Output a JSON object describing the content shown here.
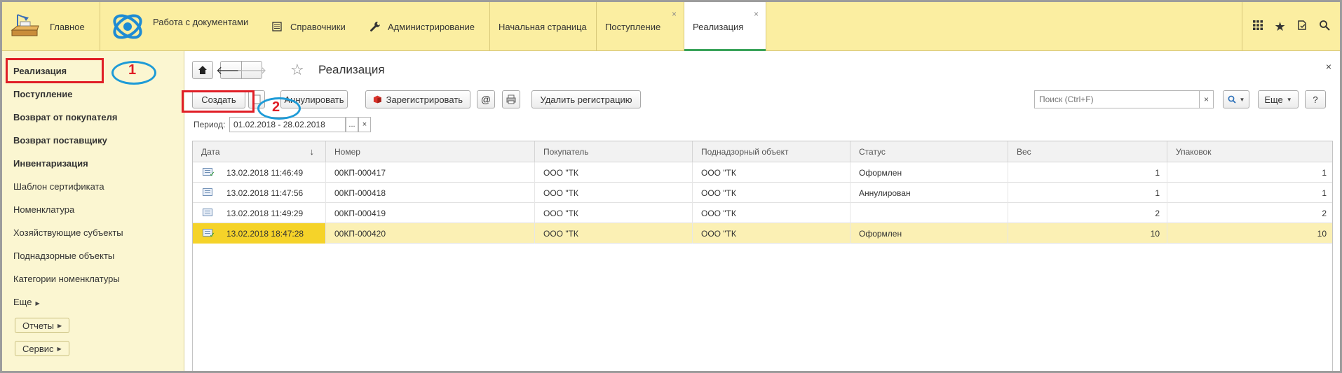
{
  "topbar": {
    "home_label": "Главное",
    "docs_label": "Работа с документами",
    "ref_label": "Справочники",
    "admin_label": "Администрирование",
    "tabs": [
      {
        "label": "Начальная страница"
      },
      {
        "label": "Поступление",
        "close": "×"
      },
      {
        "label": "Реализация",
        "close": "×"
      }
    ],
    "icons": [
      "grid-icon",
      "star-icon",
      "history-icon",
      "search-icon"
    ]
  },
  "sidebar": {
    "items": [
      {
        "label": "Реализация"
      },
      {
        "label": "Поступление"
      },
      {
        "label": "Возврат от покупателя"
      },
      {
        "label": "Возврат поставщику"
      },
      {
        "label": "Инвентаризация"
      },
      {
        "label": "Шаблон сертификата"
      },
      {
        "label": "Номенклатура"
      },
      {
        "label": "Хозяйствующие субъекты"
      },
      {
        "label": "Поднадзорные объекты"
      },
      {
        "label": "Категории номенклатуры"
      },
      {
        "label": "Еще"
      }
    ],
    "reports_btn": "Отчеты",
    "service_btn": "Сервис"
  },
  "annotations": {
    "one": "1",
    "two": "2"
  },
  "main": {
    "title": "Реализация",
    "close": "×",
    "toolbar": {
      "create": "Создать",
      "annul": "Аннулировать",
      "register": "Зарегистрировать",
      "at": "@",
      "delete_reg": "Удалить регистрацию",
      "more": "Еще",
      "help": "?"
    },
    "search": {
      "placeholder": "Поиск (Ctrl+F)",
      "clear": "×"
    },
    "period": {
      "label": "Период:",
      "value": "01.02.2018 - 28.02.2018",
      "dots": "...",
      "clear": "×"
    },
    "table": {
      "columns": [
        "Дата",
        "Номер",
        "Покупатель",
        "Поднадзорный объект",
        "Статус",
        "Вес",
        "Упаковок"
      ],
      "sort_indicator": "↓",
      "rows": [
        {
          "date": "13.02.2018 11:46:49",
          "number": "00КП-000417",
          "buyer": "ООО \"ТК",
          "object": "ООО \"ТК",
          "status": "Оформлен",
          "weight": "1",
          "packs": "1",
          "checked": true
        },
        {
          "date": "13.02.2018 11:47:56",
          "number": "00КП-000418",
          "buyer": "ООО \"ТК",
          "object": "ООО \"ТК",
          "status": "Аннулирован",
          "weight": "1",
          "packs": "1",
          "checked": false
        },
        {
          "date": "13.02.2018 11:49:29",
          "number": "00КП-000419",
          "buyer": "ООО \"ТК",
          "object": "ООО \"ТК",
          "status": "",
          "weight": "2",
          "packs": "2",
          "checked": false
        },
        {
          "date": "13.02.2018 18:47:28",
          "number": "00КП-000420",
          "buyer": "ООО \"ТК",
          "object": "ООО \"ТК",
          "status": "Оформлен",
          "weight": "10",
          "packs": "10",
          "checked": true
        }
      ]
    }
  },
  "colors": {
    "topbar": "#fbeea1",
    "sidebar": "#fbf6d1",
    "selected_row": "#fbf0b4",
    "selected_cell": "#f5d329",
    "annotation_red": "#e01e26",
    "annotation_blue": "#1e9bd7",
    "active_tab_underline": "#3aa35a"
  }
}
